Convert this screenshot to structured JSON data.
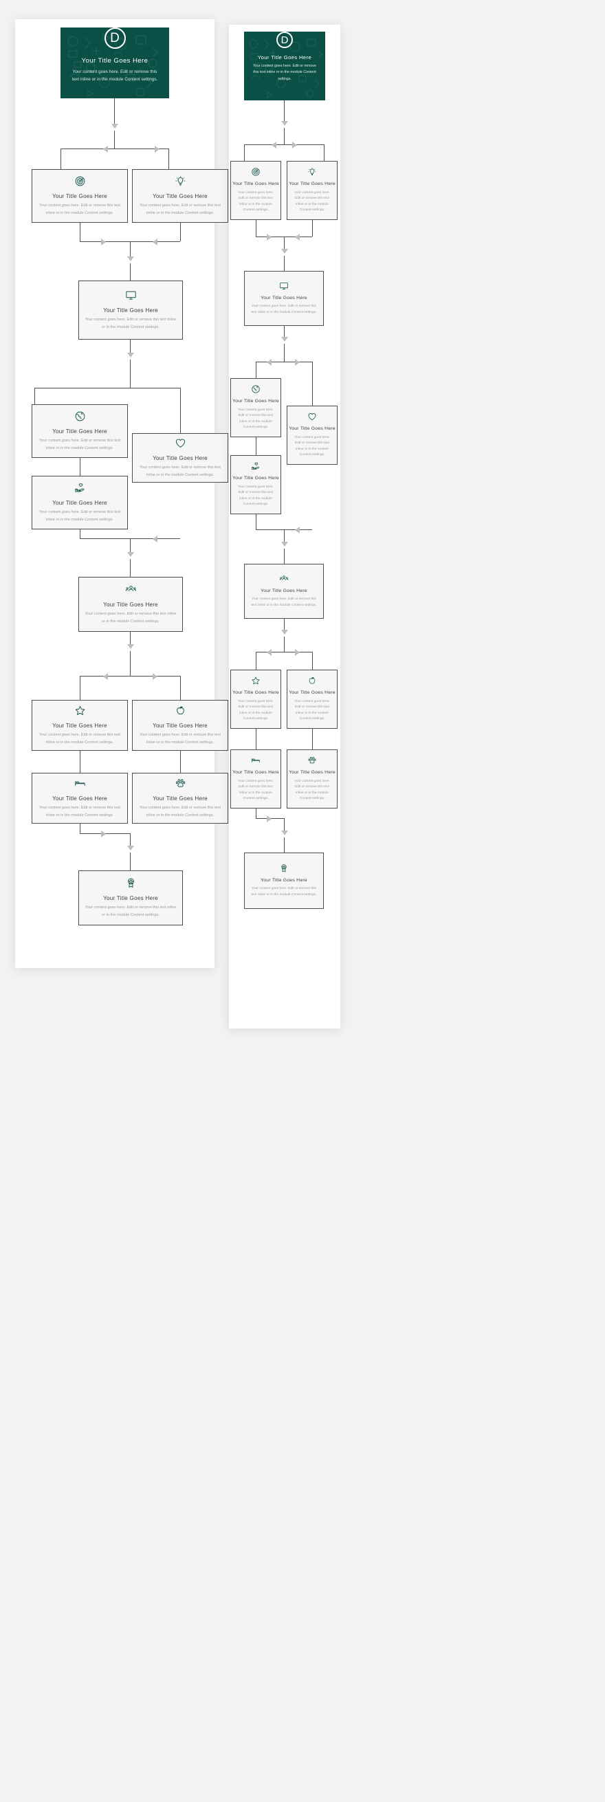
{
  "theme": {
    "brand_green": "#0b5046",
    "card_bg": "#f6f6f6",
    "card_border": "#4a4f52",
    "connector": "#4a4f52",
    "arrow": "#bdbdbd",
    "title_color": "#3b4043",
    "body_color": "#9a9a9a",
    "page_bg": "#f2f2f2",
    "panel_bg": "#ffffff"
  },
  "hero": {
    "logo_letter": "D",
    "logo_icon": "divi-logo-icon",
    "title": "Your Title Goes Here",
    "body": "Your content goes here. Edit or remove this text inline or in the module Content settings."
  },
  "node_defaults": {
    "title": "Your Title Goes Here",
    "body": "Your content goes here. Edit or remove this text inline or in the module Content settings."
  },
  "nodes": [
    {
      "id": "n1",
      "icon": "target-icon",
      "title": "Your Title Goes Here",
      "body": "Your content goes here. Edit or remove this text inline or in the module Content settings."
    },
    {
      "id": "n2",
      "icon": "lightbulb-icon",
      "title": "Your Title Goes Here",
      "body": "Your content goes here. Edit or remove this text inline or in the module Content settings."
    },
    {
      "id": "n3",
      "icon": "monitor-icon",
      "title": "Your Title Goes Here",
      "body": "Your content goes here. Edit or remove this text inline or in the module Content settings."
    },
    {
      "id": "n4",
      "icon": "globe-icon",
      "title": "Your Title Goes Here",
      "body": "Your content goes here. Edit or remove this text inline or in the module Content settings."
    },
    {
      "id": "n5",
      "icon": "heart-icon",
      "title": "Your Title Goes Here",
      "body": "Your content goes here. Edit or remove this text inline or in the module Content settings."
    },
    {
      "id": "n6",
      "icon": "hand-heart-icon",
      "title": "Your Title Goes Here",
      "body": "Your content goes here. Edit or remove this text inline or in the module Content settings."
    },
    {
      "id": "n7",
      "icon": "people-group-icon",
      "title": "Your Title Goes Here",
      "body": "Your content goes here. Edit or remove this text inline or in the module Content settings."
    },
    {
      "id": "n8",
      "icon": "star-icon",
      "title": "Your Title Goes Here",
      "body": "Your content goes here. Edit or remove this text inline or in the module Content settings."
    },
    {
      "id": "n9",
      "icon": "apple-icon",
      "title": "Your Title Goes Here",
      "body": "Your content goes here. Edit or remove this text inline or in the module Content settings."
    },
    {
      "id": "n10",
      "icon": "bed-icon",
      "title": "Your Title Goes Here",
      "body": "Your content goes here. Edit or remove this text inline or in the module Content settings."
    },
    {
      "id": "n11",
      "icon": "paw-icon",
      "title": "Your Title Goes Here",
      "body": "Your content goes here. Edit or remove this text inline or in the module Content settings."
    },
    {
      "id": "n12",
      "icon": "award-ribbon-icon",
      "title": "Your Title Goes Here",
      "body": "Your content goes here. Edit or remove this text inline or in the module Content settings."
    }
  ]
}
